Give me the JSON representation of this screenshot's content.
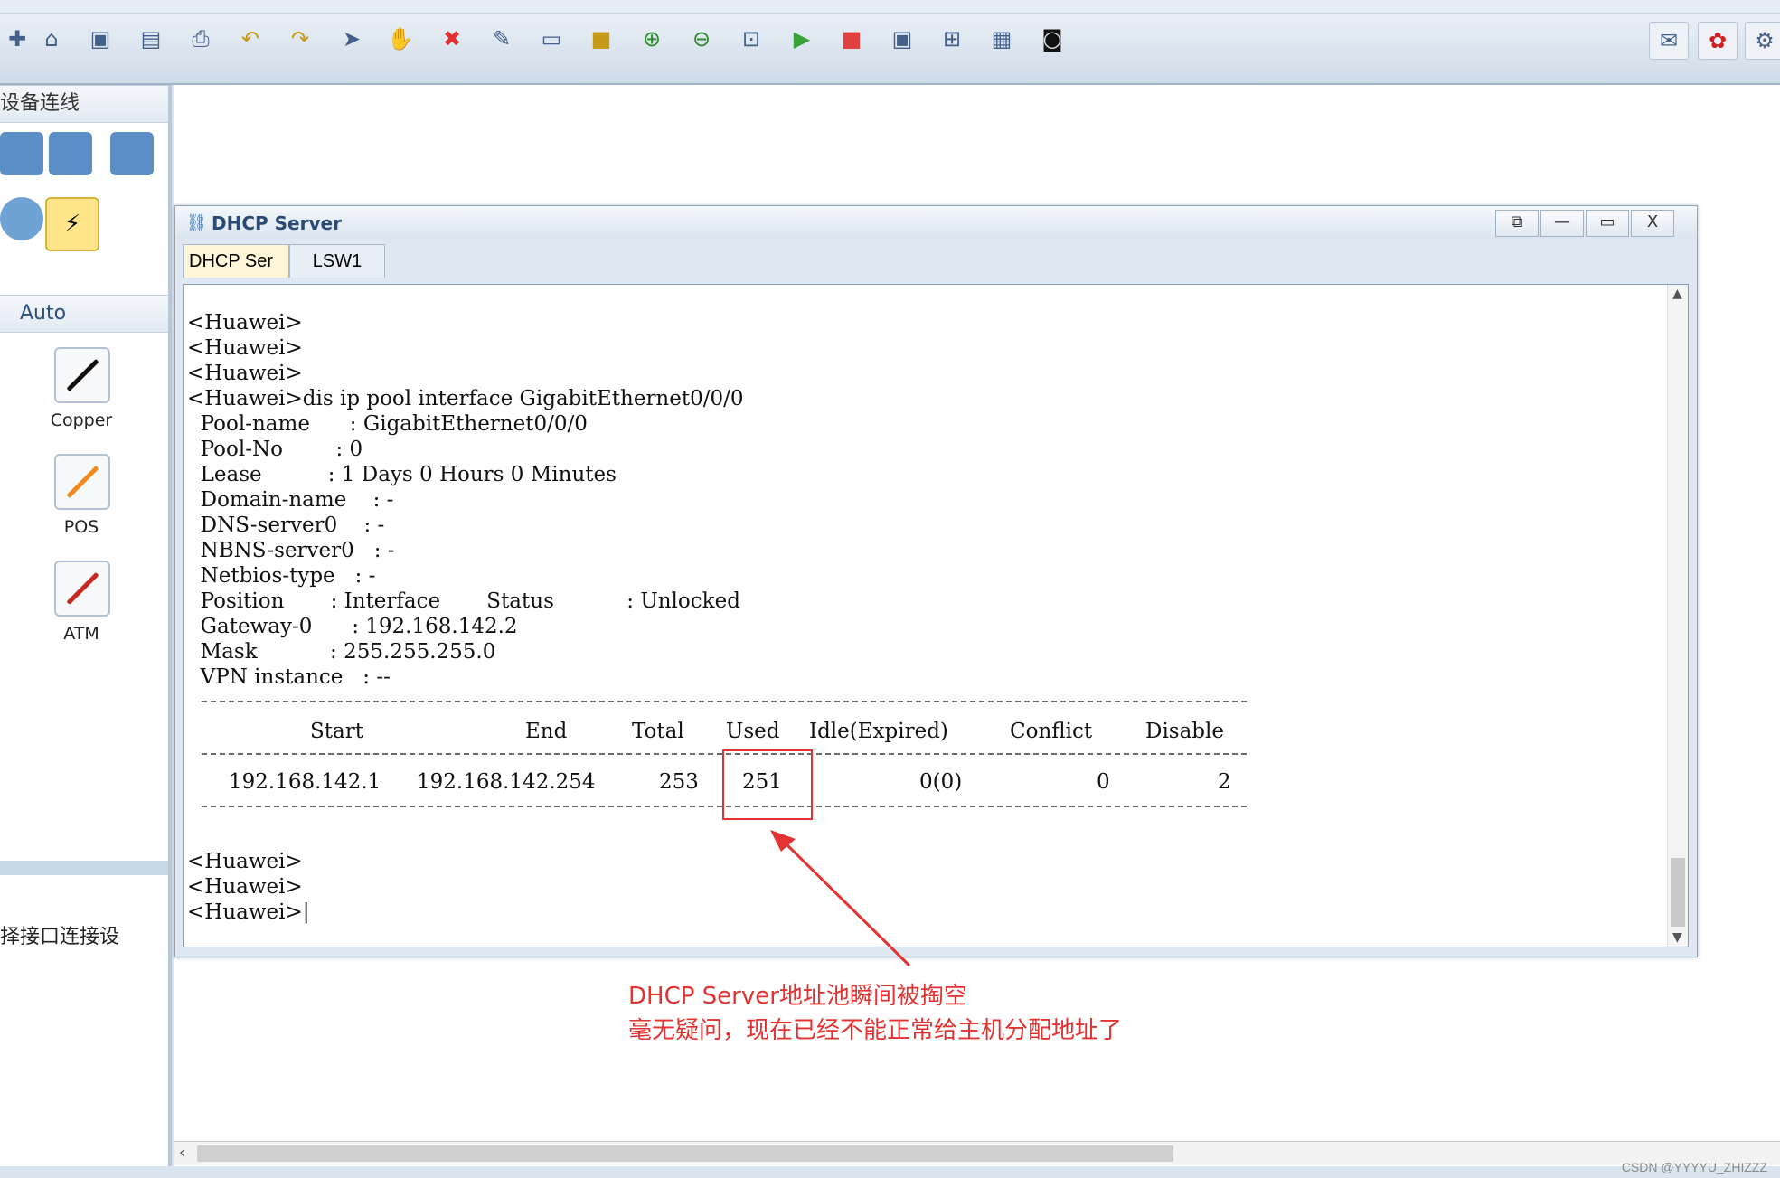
{
  "sidebar": {
    "section1_title": "设备连线",
    "section2_title": "Auto",
    "cables": [
      {
        "label": "Copper",
        "color": "#111111"
      },
      {
        "label": "POS",
        "color": "#f08a1e"
      },
      {
        "label": "ATM",
        "color": "#c8281f"
      }
    ],
    "hint_text": "择接口连接设"
  },
  "window": {
    "title": "DHCP Server",
    "tabs": [
      "DHCP Ser",
      "LSW1"
    ],
    "buttons": {
      "restore": "⧉",
      "minimize": "—",
      "maximize": "▭",
      "close": "X"
    }
  },
  "console": {
    "lines_before": [
      "<Huawei>",
      "<Huawei>",
      "<Huawei>",
      "<Huawei>dis ip pool interface GigabitEthernet0/0/0",
      "  Pool-name      : GigabitEthernet0/0/0",
      "  Pool-No        : 0",
      "  Lease          : 1 Days 0 Hours 0 Minutes",
      "  Domain-name    : -",
      "  DNS-server0    : -",
      "  NBNS-server0   : -",
      "  Netbios-type   : -",
      "  Position       : Interface       Status           : Unlocked",
      "  Gateway-0      : 192.168.142.2",
      "  Mask           : 255.255.255.0",
      "  VPN instance   : --"
    ],
    "table_headers": [
      "Start",
      "End",
      "Total",
      "Used",
      "Idle(Expired)",
      "Conflict",
      "Disable"
    ],
    "table_row": [
      "192.168.142.1",
      "192.168.142.254",
      "253",
      "251",
      "0(0)",
      "0",
      "2"
    ],
    "lines_after": [
      "<Huawei>",
      "<Huawei>",
      "<Huawei>|"
    ]
  },
  "annotation": {
    "line1": "DHCP Server地址池瞬间被掏空",
    "line2": "毫无疑问，现在已经不能正常给主机分配地址了",
    "color": "#e23232"
  },
  "watermark": "CSDN @YYYYU_ZHIZZZ",
  "toolbar_icons": [
    "new-icon",
    "open-icon",
    "save-icon",
    "save-as-icon",
    "print-icon",
    "undo-icon",
    "redo-icon",
    "select-icon",
    "hand-icon",
    "delete-icon",
    "delete-link-icon",
    "text-icon",
    "rectangle-icon",
    "zoom-in-icon",
    "zoom-out-icon",
    "fit-icon",
    "start-icon",
    "stop-icon",
    "capture-icon",
    "topology-icon",
    "grid-icon",
    "cli-icon",
    "chat-icon",
    "huawei-logo-icon",
    "settings-icon"
  ]
}
